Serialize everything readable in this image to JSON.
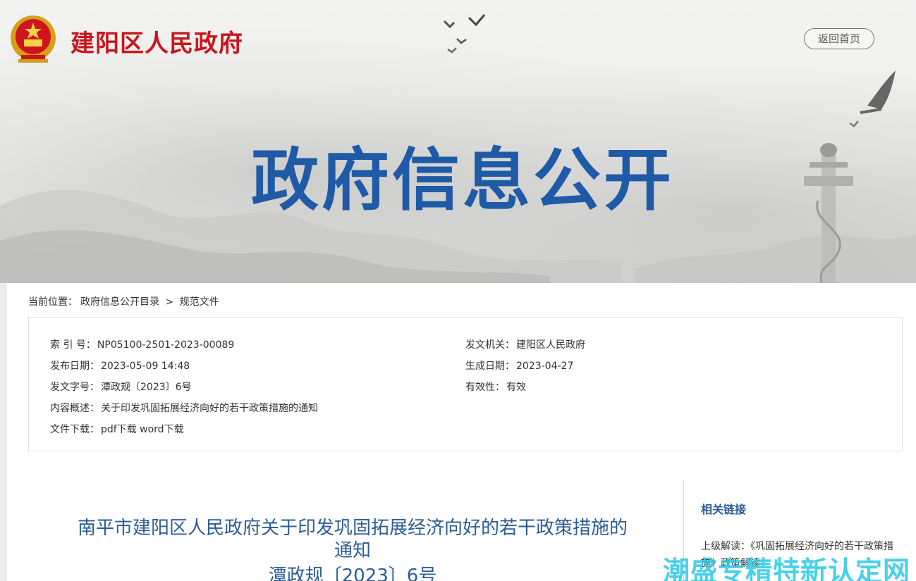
{
  "header": {
    "site_title": "建阳区人民政府",
    "home_button": "返回首页",
    "banner_title": "政府信息公开"
  },
  "breadcrumb": {
    "prefix": "当前位置：",
    "items": [
      "政府信息公开目录",
      "规范文件"
    ],
    "separator": ">"
  },
  "meta": {
    "index_label": "索 引 号：",
    "index_value": "NP05100-2501-2023-00089",
    "issuer_label": "发文机关：",
    "issuer_value": "建阳区人民政府",
    "publish_label": "发布日期：",
    "publish_value": "2023-05-09 14:48",
    "created_label": "生成日期：",
    "created_value": "2023-04-27",
    "docno_label": "发文字号：",
    "docno_value": "潭政规〔2023〕6号",
    "validity_label": "有效性：",
    "validity_value": "有效",
    "summary_label": "内容概述：",
    "summary_value": "关于印发巩固拓展经济向好的若干政策措施的通知",
    "download_label": "文件下载：",
    "download_pdf": "pdf下载",
    "download_word": "word下载"
  },
  "document": {
    "title_line1": "南平市建阳区人民政府关于印发巩固拓展经济向好的若干政策措施的",
    "title_line2": "通知",
    "number": "潭政规〔2023〕6号"
  },
  "sidebar": {
    "title": "相关链接",
    "link_text": "上级解读：《巩固拓展经济向好的若干政策措施》政策解读"
  },
  "watermark": "潮盛专精特新认定网",
  "colors": {
    "brand_red": "#c8161d",
    "banner_blue": "#1f5aa6",
    "doc_title_blue": "#2b5d95"
  }
}
